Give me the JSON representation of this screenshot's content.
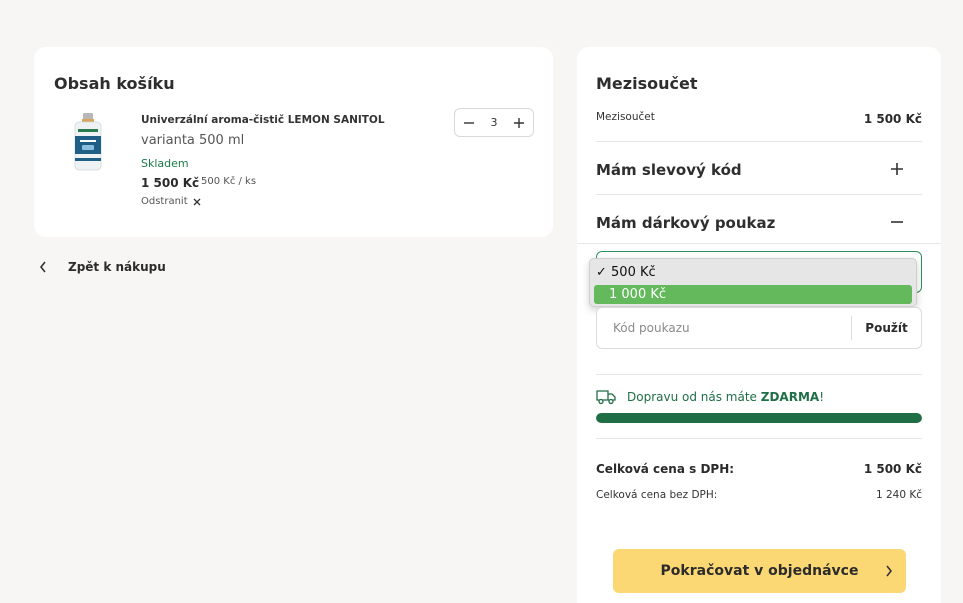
{
  "cart": {
    "title": "Obsah košíku",
    "item": {
      "name": "Univerzální aroma-čistič LEMON SANITOL",
      "variant": "varianta 500 ml",
      "stock": "Skladem",
      "price": "1 500 Kč",
      "unit_price": "500 Kč / ks",
      "quantity": "3",
      "remove_label": "Odstranit"
    }
  },
  "back_link": {
    "label": "Zpět k nákupu"
  },
  "summary": {
    "title": "Mezisoučet",
    "subtotal_label": "Mezisoučet",
    "subtotal_value": "1 500 Kč",
    "discount_label": "Mám slevový kód",
    "gift_label": "Mám dárkový poukaz",
    "voucher_options": [
      {
        "label": "500 Kč",
        "selected": true
      },
      {
        "label": "1 000 Kč",
        "highlighted": true
      }
    ],
    "voucher_placeholder": "Kód poukazu",
    "apply_label": "Použít",
    "shipping_text": "Dopravu od nás máte",
    "shipping_free": "ZDARMA",
    "shipping_suffix": "!",
    "shipping_progress_percent": 100,
    "total_label": "Celková cena s DPH:",
    "total_value": "1 500 Kč",
    "net_label": "Celková cena bez DPH:",
    "net_value": "1 240 Kč",
    "continue_label": "Pokračovat v objednávce"
  },
  "colors": {
    "brand_green": "#1f6e45",
    "cta_yellow": "#fbd874",
    "option_highlight": "#63b95c",
    "page_bg": "#f7f6f4"
  },
  "icons": [
    "minus-icon",
    "plus-icon",
    "close-icon",
    "chevron-left-icon",
    "chevron-right-icon",
    "truck-icon",
    "check-icon"
  ]
}
